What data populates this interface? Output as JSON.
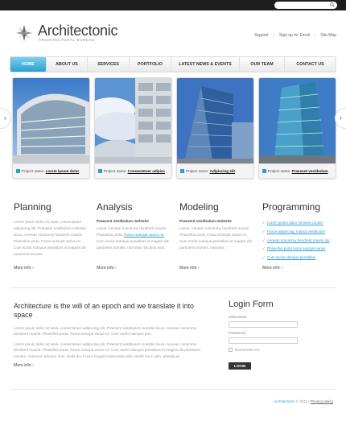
{
  "search": {
    "placeholder": ""
  },
  "logo": {
    "title": "Architectonic",
    "subtitle": "ARCHITECTURAL BUREAU"
  },
  "toplinks": {
    "support": "Support",
    "signup": "Sign up for Email",
    "sitemap": "Site Map"
  },
  "nav": [
    {
      "label": "HOME",
      "active": true
    },
    {
      "label": "ABOUT US"
    },
    {
      "label": "SERVICES"
    },
    {
      "label": "PORTFOLIO"
    },
    {
      "label": "LATEST NEWS & EVENTS"
    },
    {
      "label": "OUR TEAM"
    },
    {
      "label": "CONTACT US"
    }
  ],
  "slides": [
    {
      "prefix": "Project name:",
      "name": "Lorem ipsum dolor"
    },
    {
      "prefix": "Project name:",
      "name": "Consectetuer adipisc"
    },
    {
      "prefix": "Project name:",
      "name": "Adipiscing elit"
    },
    {
      "prefix": "Project name:",
      "name": "Praesent vestibulum"
    }
  ],
  "columns": {
    "planning": {
      "title": "Planning",
      "text": "Lorem ipsum dolor sit amet, consectetuer adipiscing elit. Praesent vestibulum molestie lacus. Aenean nonummy hendrerit mauris. Phasellus porta. Fusce suscipit varius mi. Cum sociis natoque penatibus et magnis dis parturient montes.",
      "more": "More info"
    },
    "analysis": {
      "title": "Analysis",
      "lead": "Praesent vestibulum molestie",
      "text_a": "Lacus. Aenean nonummy hendrerit mauris. Phasellus porta.",
      "link": "Fusce suscipit varius mi.",
      "text_b": "Cum sociis natoque penatibus et magnis dis parturient montes, nascetur ridiculus mus.",
      "more": "More info"
    },
    "modeling": {
      "title": "Modeling",
      "lead": "Praesent vestibulum molestie",
      "text": "Lacus. Aenean nonummy hendrerit mauris. Phasellus porta. Fusce suscipit varius mi. Cum sociis natoque penatibus et magnis dis parturient montes, nascetur.",
      "more": "More info"
    },
    "programming": {
      "title": "Programming",
      "items": [
        "Lorem ipsum dolor sit amet consec",
        "Fusce adipiscing, massa vestibulum",
        "Aenean nonummy hendrerit mauris dui",
        "Phasellus porta fusce suscipit varius",
        "Cum sociis natoque penatibus"
      ],
      "more": "More info"
    }
  },
  "about": {
    "heading": "Architecture is the will of an epoch and we translate it into space",
    "p1": "Lorem ipsum dolor sit amet, consectetuer adipiscing elit. Praesent vestibulum molestie lacus. Aenean nonummy hendrerit mauris. Phasellus porta. Fusce suscipit varius mi. Cum sociis natoque pen.",
    "p2": "Lorem ipsum dolor sit amet, consectetuer adipiscing elit. Praesent vestibulum molestie lacus. Aenean nonummy hendrerit mauris. Phasellus porta. Fusce suscipit varius mi. Cum sociis natoque penatibus et magnis dis parturient montes, nascetur ridiculus mus. Nulla dui. Fusce feugiat malesuada odio. Morbi nunc odio, gravida at.",
    "more": "More info"
  },
  "login": {
    "title": "Login Form",
    "username_label": "Username:",
    "password_label": "Password:",
    "remember": "Remember me",
    "button": "LOGIN"
  },
  "footer": {
    "brand": "Architectonic",
    "copy": "© 2011",
    "sep": "|",
    "privacy": "Privacy policy"
  },
  "colors": {
    "accent": "#2a9fd6",
    "topbar": "#1e1e1e"
  },
  "icons": {
    "search": "search-icon",
    "check": "check-icon",
    "prev": "chevron-left-icon",
    "next": "chevron-right-icon"
  }
}
